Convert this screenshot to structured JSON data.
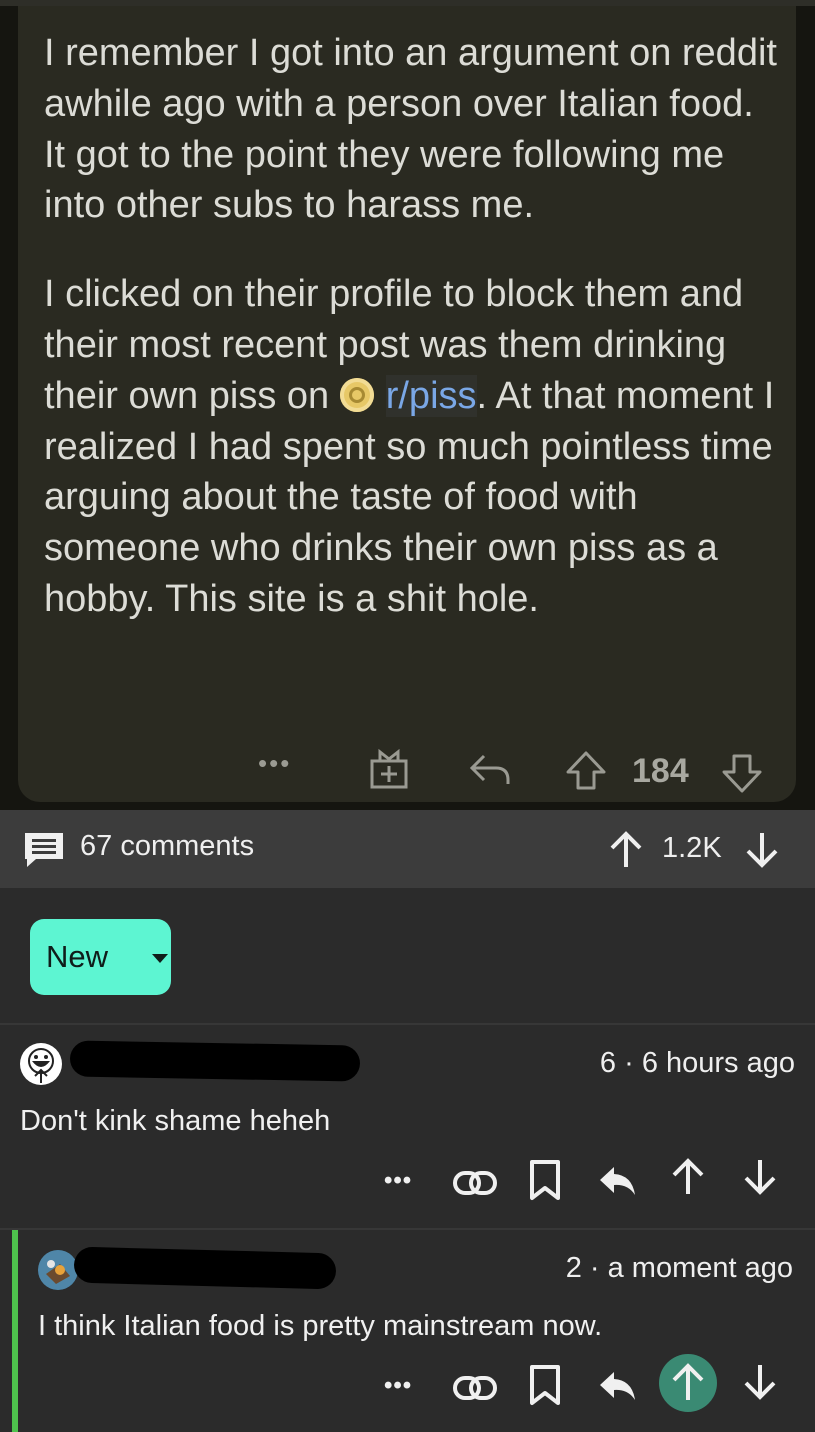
{
  "post": {
    "paragraphs": [
      "I remember I got into an argument on reddit awhile ago with a person over Italian food. It got to the point they were following me into other subs to harass me."
    ],
    "p2_before": "I clicked on their profile to block them and their most recent post was them drinking their own piss on",
    "subreddit_link": "r/piss",
    "p2_after": ". At that moment I realized I had spent so much pointless time arguing about the taste of food with someone who drinks their own piss as a hobby. This site is a shit hole.",
    "more_label": "•••",
    "vote_count": "184",
    "icons": [
      "gift-icon",
      "reply-arrow-icon",
      "upvote-outline-icon",
      "downvote-outline-icon"
    ]
  },
  "bar": {
    "comments_label": "67 comments",
    "score": "1.2K",
    "icons": [
      "comments-icon",
      "upvote-icon",
      "downvote-icon"
    ]
  },
  "sort": {
    "label": "New",
    "accent": "#5df5d2"
  },
  "comments": [
    {
      "meta": "6 · 6 hours ago",
      "text": "Don't kink shame heheh",
      "more_label": "•••",
      "upvoted": false
    },
    {
      "meta": "2 · a moment ago",
      "text": "I think Italian food is pretty mainstream now.",
      "more_label": "•••",
      "upvoted": true,
      "thread_color": "#4ec24d",
      "upvote_color": "#3a8a73"
    }
  ]
}
